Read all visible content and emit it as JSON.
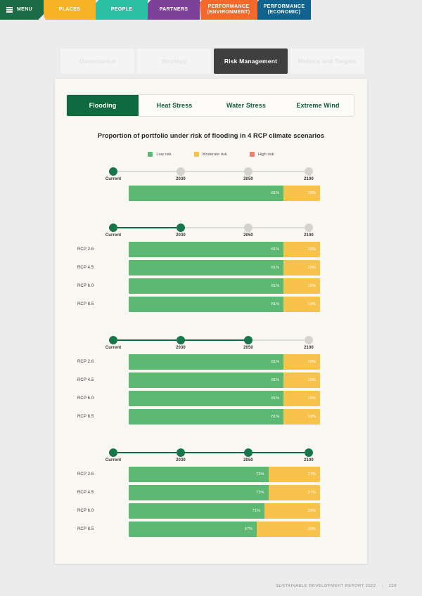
{
  "topnav": {
    "items": [
      {
        "label": "MENU",
        "icon": "hamburger-icon",
        "color": "#1b6b45"
      },
      {
        "label": "PLACES",
        "color": "#f5b325"
      },
      {
        "label": "PEOPLE",
        "color": "#2bbfa3"
      },
      {
        "label": "PARTNERS",
        "color": "#7d4199"
      },
      {
        "label": "PERFORMANCE\n(ENVIRONMENT)",
        "line1": "PERFORMANCE",
        "line2": "(ENVIRONMENT)",
        "color": "#f4692b"
      },
      {
        "label": "PERFORMANCE\n(ECONOMIC)",
        "line1": "PERFORMANCE",
        "line2": "(ECONOMIC)",
        "color": "#10628f"
      }
    ]
  },
  "subnav": {
    "items": [
      {
        "label": "Governance",
        "active": false
      },
      {
        "label": "Strategy",
        "active": false
      },
      {
        "label": "Risk Management",
        "active": true
      },
      {
        "label": "Metrics and Targets",
        "active": false
      }
    ]
  },
  "hazard_tabs": {
    "items": [
      {
        "label": "Flooding",
        "active": true
      },
      {
        "label": "Heat Stress",
        "active": false
      },
      {
        "label": "Water Stress",
        "active": false
      },
      {
        "label": "Extreme Wind",
        "active": false
      }
    ]
  },
  "footer": {
    "report": "SUSTAINABLE DEVELOPMENT REPORT 2022",
    "separator": "|",
    "page": "228"
  },
  "chart_data": {
    "type": "bar",
    "title": "Proportion of portfolio under risk of flooding in 4 RCP climate scenarios",
    "xlabel": "",
    "ylabel": "",
    "xlim": [
      0,
      100
    ],
    "grid": false,
    "legend_position": "top-center",
    "legend": [
      {
        "label": "Low risk",
        "color": "#5cb873"
      },
      {
        "label": "Moderate risk",
        "color": "#f7c34a"
      },
      {
        "label": "High risk",
        "color": "#f07f6b"
      }
    ],
    "timeline_steps": [
      "Current",
      "2030",
      "2050",
      "2100"
    ],
    "groups": [
      {
        "name": "Current",
        "active_steps": [
          "Current"
        ],
        "active_count": 1,
        "rows": [
          {
            "label": "",
            "low": 81,
            "moderate": 19,
            "high": 0,
            "low_label": "81%",
            "moderate_label": "19%"
          }
        ]
      },
      {
        "name": "2030",
        "active_steps": [
          "Current",
          "2030"
        ],
        "active_count": 2,
        "rows": [
          {
            "label": "RCP 2.6",
            "low": 81,
            "moderate": 19,
            "high": 0,
            "low_label": "81%",
            "moderate_label": "19%"
          },
          {
            "label": "RCP 4.5",
            "low": 81,
            "moderate": 19,
            "high": 0,
            "low_label": "81%",
            "moderate_label": "19%"
          },
          {
            "label": "RCP 6.0",
            "low": 81,
            "moderate": 19,
            "high": 0,
            "low_label": "81%",
            "moderate_label": "19%"
          },
          {
            "label": "RCP 8.5",
            "low": 81,
            "moderate": 19,
            "high": 0,
            "low_label": "81%",
            "moderate_label": "19%"
          }
        ]
      },
      {
        "name": "2050",
        "active_steps": [
          "Current",
          "2030",
          "2050"
        ],
        "active_count": 3,
        "rows": [
          {
            "label": "RCP 2.6",
            "low": 81,
            "moderate": 19,
            "high": 0,
            "low_label": "81%",
            "moderate_label": "19%"
          },
          {
            "label": "RCP 4.5",
            "low": 81,
            "moderate": 19,
            "high": 0,
            "low_label": "81%",
            "moderate_label": "19%"
          },
          {
            "label": "RCP 6.0",
            "low": 81,
            "moderate": 19,
            "high": 0,
            "low_label": "81%",
            "moderate_label": "19%"
          },
          {
            "label": "RCP 8.5",
            "low": 81,
            "moderate": 19,
            "high": 0,
            "low_label": "81%",
            "moderate_label": "19%"
          }
        ]
      },
      {
        "name": "2100",
        "active_steps": [
          "Current",
          "2030",
          "2050",
          "2100"
        ],
        "active_count": 4,
        "rows": [
          {
            "label": "RCP 2.6",
            "low": 73,
            "moderate": 27,
            "high": 0,
            "low_label": "73%",
            "moderate_label": "27%"
          },
          {
            "label": "RCP 4.5",
            "low": 73,
            "moderate": 27,
            "high": 0,
            "low_label": "73%",
            "moderate_label": "27%"
          },
          {
            "label": "RCP 6.0",
            "low": 71,
            "moderate": 29,
            "high": 0,
            "low_label": "71%",
            "moderate_label": "29%"
          },
          {
            "label": "RCP 8.5",
            "low": 67,
            "moderate": 33,
            "high": 0,
            "low_label": "67%",
            "moderate_label": "33%"
          }
        ]
      }
    ]
  }
}
